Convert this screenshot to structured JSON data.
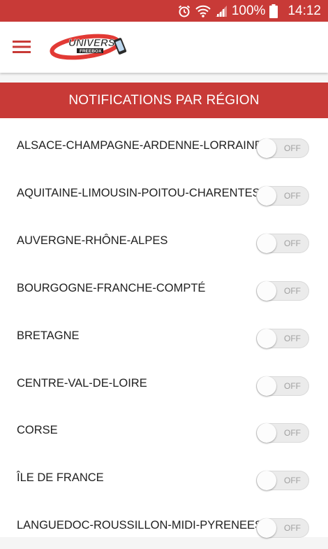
{
  "status_bar": {
    "battery_percent": "100%",
    "time": "14:12",
    "icons": [
      "alarm-icon",
      "wifi-icon",
      "signal-icon",
      "battery-icon"
    ]
  },
  "app_bar": {
    "menu_icon": "hamburger-menu-icon",
    "logo_text": "UNIVERS",
    "logo_subtext": "FREEBOX"
  },
  "section": {
    "title": "NOTIFICATIONS PAR RÉGION"
  },
  "regions": [
    {
      "label": "ALSACE-CHAMPAGNE-ARDENNE-LORRAINE",
      "toggle": "OFF"
    },
    {
      "label": "AQUITAINE-LIMOUSIN-POITOU-CHARENTES",
      "toggle": "OFF"
    },
    {
      "label": "AUVERGNE-RHÔNE-ALPES",
      "toggle": "OFF"
    },
    {
      "label": "BOURGOGNE-FRANCHE-COMPTÉ",
      "toggle": "OFF"
    },
    {
      "label": "BRETAGNE",
      "toggle": "OFF"
    },
    {
      "label": "CENTRE-VAL-DE-LOIRE",
      "toggle": "OFF"
    },
    {
      "label": "CORSE",
      "toggle": "OFF"
    },
    {
      "label": "ÎLE DE FRANCE",
      "toggle": "OFF"
    },
    {
      "label": "LANGUEDOC-ROUSSILLON-MIDI-PYRENEES",
      "toggle": "OFF"
    }
  ],
  "colors": {
    "accent": "#c83a37",
    "toggle_off_track": "#ebebeb",
    "text": "#212121"
  }
}
